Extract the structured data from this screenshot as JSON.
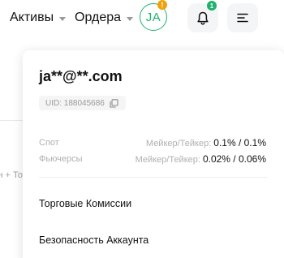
{
  "header": {
    "nav_assets": "Активы",
    "nav_orders": "Ордера",
    "avatar_initials": "JA",
    "avatar_badge": "!",
    "notifications_count": "1"
  },
  "background": {
    "partial_text": "н + То"
  },
  "account": {
    "email": "ja**@**.com",
    "uid": "UID: 188045686",
    "fees": [
      {
        "label": "Спот",
        "maker_taker": "Мейкер/Тейкер:",
        "value": "0.1% / 0.1%"
      },
      {
        "label": "Фьючерсы",
        "maker_taker": "Мейкер/Тейкер:",
        "value": "0.02% / 0.06%"
      }
    ],
    "links": {
      "trading_fees": "Торговые Комиссии",
      "account_security": "Безопасность Аккаунта"
    }
  },
  "colors": {
    "accent_green": "#20b26c",
    "badge_orange": "#f0a20b"
  },
  "icons": {
    "notifications": "bell-icon",
    "menu": "menu-lines-icon",
    "copy": "copy-icon",
    "dropdown": "chevron-down-icon"
  }
}
